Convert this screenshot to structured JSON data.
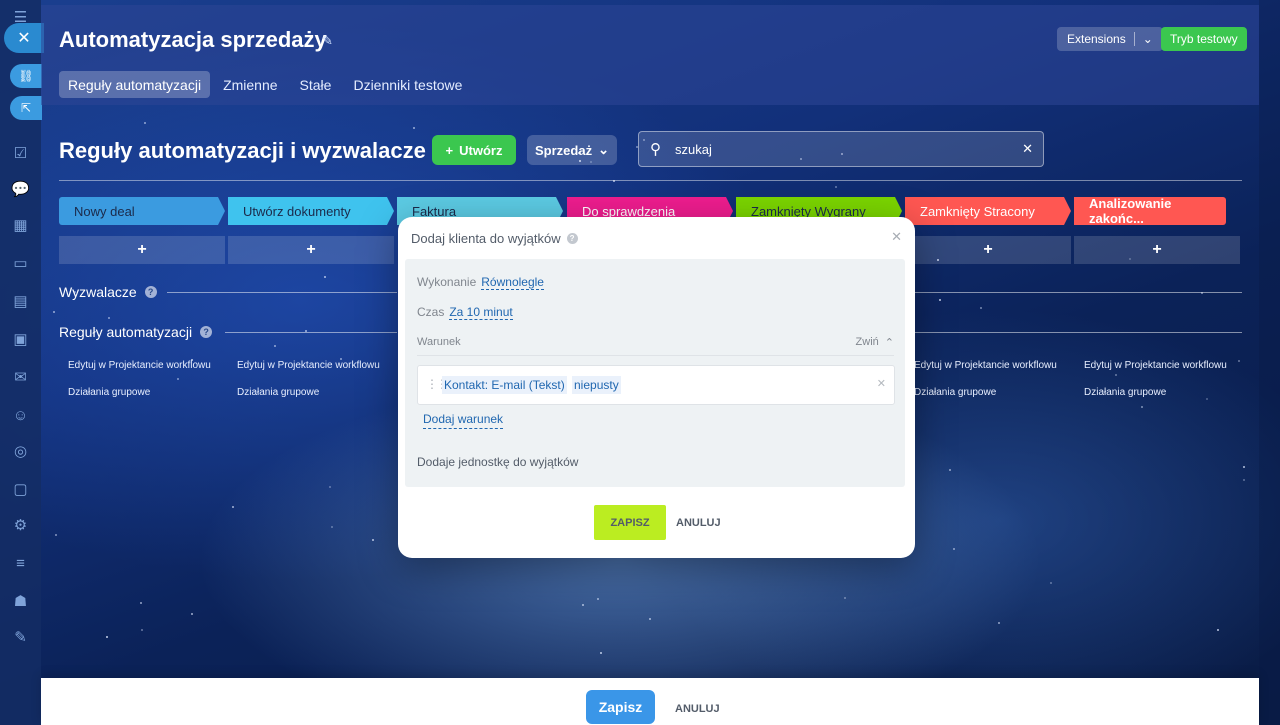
{
  "header": {
    "title": "Automatyzacja sprzedaży",
    "extensions_label": "Extensions",
    "test_mode_label": "Tryb testowy",
    "tabs": [
      {
        "label": "Reguły automatyzacji",
        "active": true
      },
      {
        "label": "Zmienne",
        "active": false
      },
      {
        "label": "Stałe",
        "active": false
      },
      {
        "label": "Dzienniki testowe",
        "active": false
      }
    ]
  },
  "toolbar": {
    "section_title": "Reguły automatyzacji i wyzwalacze",
    "create_label": "Utwórz",
    "pipeline_label": "Sprzedaż",
    "search_placeholder": "szukaj"
  },
  "stages": [
    {
      "label": "Nowy deal",
      "color": "#3b9be0"
    },
    {
      "label": "Utwórz dokumenty",
      "color": "#3fc3ee"
    },
    {
      "label": "Faktura",
      "color": "#5ccbe4"
    },
    {
      "label": "Do sprawdzenia",
      "color": "#ef1d8f"
    },
    {
      "label": "Zamknięty Wygrany",
      "color": "#7bd500"
    },
    {
      "label": "Zamknięty Stracony",
      "color": "#ff5752"
    },
    {
      "label": "Analizowanie zakońc...",
      "color": "#ff5752"
    }
  ],
  "rows": {
    "triggers_label": "Wyzwalacze",
    "rules_label": "Reguły automatyzacji",
    "edit_link": "Edytuj w Projektancie workflowu",
    "group_link": "Działania grupowe"
  },
  "modal": {
    "title": "Dodaj klienta do wyjątków",
    "execution_label": "Wykonanie",
    "execution_value": "Równolegle",
    "time_label": "Czas",
    "time_value": "Za 10 minut",
    "condition_label": "Warunek",
    "collapse_label": "Zwiń",
    "condition_field": "Kontakt: E-mail (Tekst)",
    "condition_operator": "niepusty",
    "add_condition_label": "Dodaj warunek",
    "description": "Dodaje jednostkę do wyjątków",
    "save_label": "ZAPISZ",
    "cancel_label": "ANULUJ"
  },
  "footer": {
    "save_label": "Zapisz",
    "cancel_label": "ANULUJ"
  },
  "colors": {
    "accent_green": "#3bc74f",
    "modal_save": "#bbed21",
    "footer_save": "#3a96e8",
    "link_blue": "#2067b0"
  }
}
